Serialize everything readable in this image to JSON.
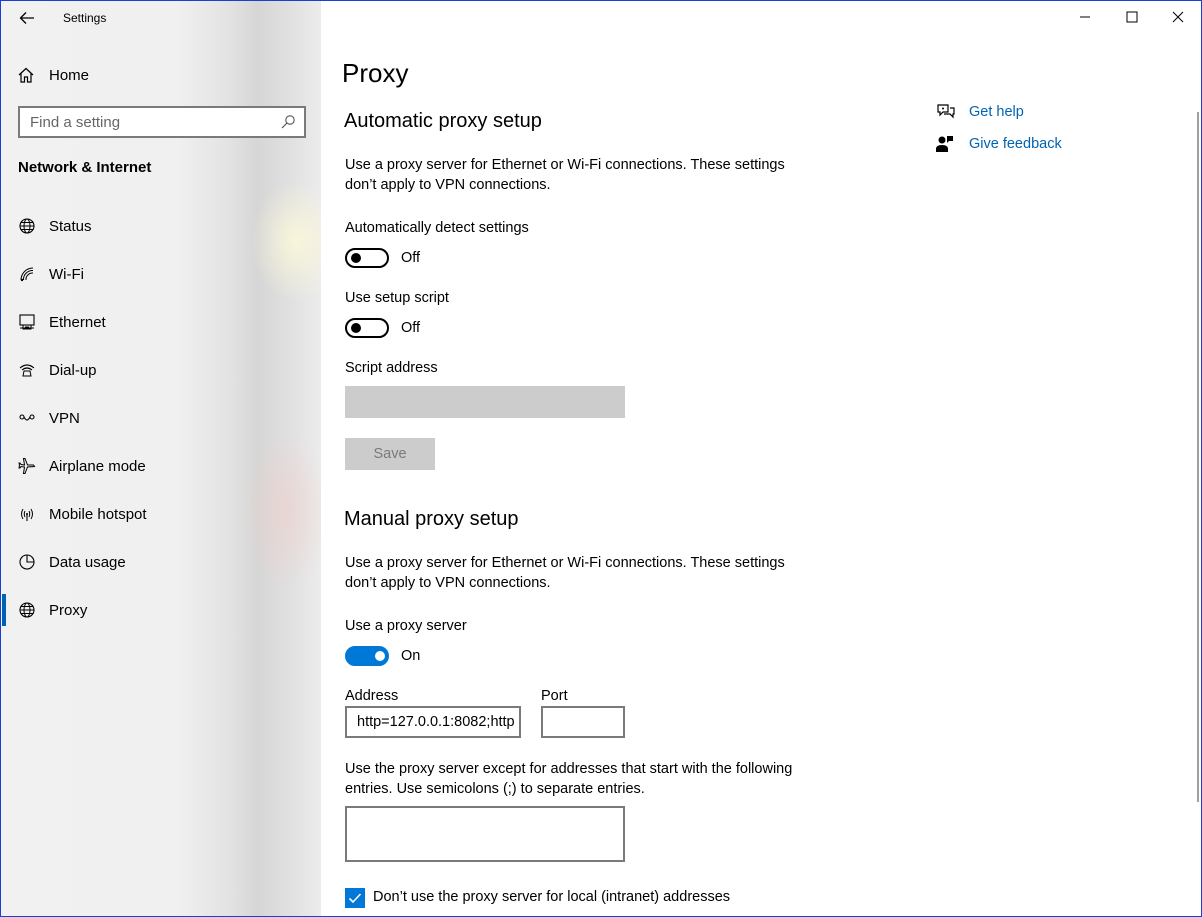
{
  "window": {
    "title": "Settings"
  },
  "sidebar": {
    "home_label": "Home",
    "search_placeholder": "Find a setting",
    "section_title": "Network & Internet",
    "items": [
      {
        "label": "Status",
        "icon": "globe-status-icon"
      },
      {
        "label": "Wi-Fi",
        "icon": "wifi-icon"
      },
      {
        "label": "Ethernet",
        "icon": "ethernet-icon"
      },
      {
        "label": "Dial-up",
        "icon": "dialup-icon"
      },
      {
        "label": "VPN",
        "icon": "vpn-icon"
      },
      {
        "label": "Airplane mode",
        "icon": "airplane-icon"
      },
      {
        "label": "Mobile hotspot",
        "icon": "hotspot-icon"
      },
      {
        "label": "Data usage",
        "icon": "data-usage-icon"
      },
      {
        "label": "Proxy",
        "icon": "globe-icon",
        "active": true
      }
    ]
  },
  "main": {
    "page_title": "Proxy",
    "auto": {
      "heading": "Automatic proxy setup",
      "description": "Use a proxy server for Ethernet or Wi-Fi connections. These settings don’t apply to VPN connections.",
      "detect_label": "Automatically detect settings",
      "detect_state": "Off",
      "script_label": "Use setup script",
      "script_state": "Off",
      "script_address_label": "Script address",
      "script_address_value": "",
      "save_label": "Save"
    },
    "manual": {
      "heading": "Manual proxy setup",
      "description": "Use a proxy server for Ethernet or Wi-Fi connections. These settings don’t apply to VPN connections.",
      "use_proxy_label": "Use a proxy server",
      "use_proxy_state": "On",
      "address_label": "Address",
      "address_value": "http=127.0.0.1:8082;http",
      "port_label": "Port",
      "port_value": "",
      "exceptions_description": "Use the proxy server except for addresses that start with the following entries. Use semicolons (;) to separate entries.",
      "exceptions_value": "",
      "local_checkbox_label": "Don’t use the proxy server for local (intranet) addresses",
      "local_checkbox_checked": true
    }
  },
  "help": {
    "get_help": "Get help",
    "give_feedback": "Give feedback"
  },
  "colors": {
    "accent": "#0078d7",
    "link": "#0063b1"
  }
}
